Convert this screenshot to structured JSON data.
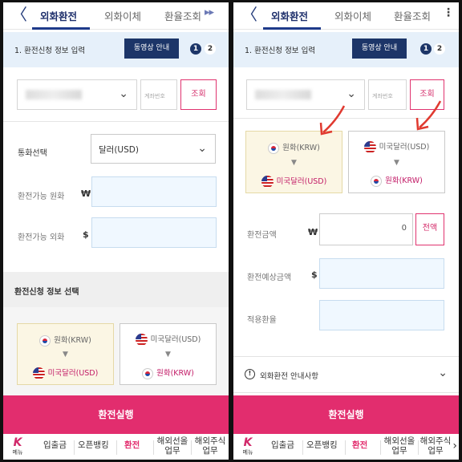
{
  "nav": {
    "back": "〈",
    "tabs": [
      "외화환전",
      "외화이체",
      "환율조회"
    ],
    "more": "▸▸",
    "dots": "⋮"
  },
  "step": {
    "title": "1. 환전신청 정보 입력",
    "guide_btn": "동영상 안내",
    "current": "1",
    "next": "2"
  },
  "account": {
    "pin_placeholder": "계좌번호",
    "search_btn": "조회"
  },
  "left": {
    "currency_label": "통화선택",
    "currency_value": "달러(USD)",
    "avail_krw_label": "환전가능 원화",
    "won_symbol": "₩",
    "avail_fx_label": "환전가능 외화",
    "dollar_symbol": "$",
    "section_title": "환전신청 정보 선택",
    "card_a_from": "원화(KRW)",
    "card_a_to": "미국달러(USD)",
    "card_b_from": "미국달러(USD)",
    "card_b_to": "원화(KRW)",
    "execute": "환전실행"
  },
  "right": {
    "card_a_from": "원화(KRW)",
    "card_a_to": "미국달러(USD)",
    "card_b_from": "미국달러(USD)",
    "card_b_to": "원화(KRW)",
    "amount_label": "환전금액",
    "won_symbol": "₩",
    "amount_value": "0",
    "full_btn": "전액",
    "expected_label": "환전예상금액",
    "dollar_symbol": "$",
    "rate_label": "적용환율",
    "info_text": "외화환전 안내사항",
    "execute": "환전실행"
  },
  "bottom_nav": {
    "logo": "K",
    "menu": "메뉴",
    "items": [
      "입출금",
      "오픈뱅킹",
      "환전",
      "해외선올\n업무",
      "해외주식\n업무"
    ],
    "next": "›"
  },
  "colors": {
    "accent_pink": "#e22d6e",
    "navy": "#1c3568",
    "annotation_red": "#e03a30"
  }
}
